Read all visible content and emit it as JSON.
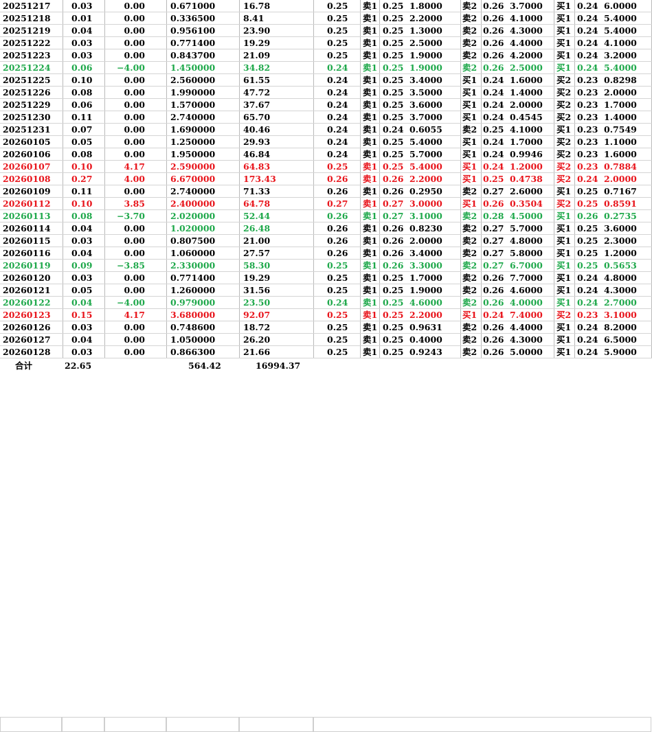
{
  "colors": {
    "up": "#e8141b",
    "down": "#1ea84a",
    "flat": "#000000"
  },
  "rows": [
    {
      "date": "20251217",
      "a": "0.03",
      "b": "0.00",
      "c": "0.671000",
      "d": "16.78",
      "p": "0.25",
      "s1l": "卖1",
      "s1p": "0.25",
      "s1v": "1.8000",
      "s2l": "卖2",
      "s2p": "0.26",
      "s2v": "3.7000",
      "b1l": "买1",
      "b1p": "0.24",
      "b1v": "6.0000",
      "t": "flat"
    },
    {
      "date": "20251218",
      "a": "0.01",
      "b": "0.00",
      "c": "0.336500",
      "d": "8.41",
      "p": "0.25",
      "s1l": "卖1",
      "s1p": "0.25",
      "s1v": "2.2000",
      "s2l": "卖2",
      "s2p": "0.26",
      "s2v": "4.1000",
      "b1l": "买1",
      "b1p": "0.24",
      "b1v": "5.4000",
      "t": "flat"
    },
    {
      "date": "20251219",
      "a": "0.04",
      "b": "0.00",
      "c": "0.956100",
      "d": "23.90",
      "p": "0.25",
      "s1l": "卖1",
      "s1p": "0.25",
      "s1v": "1.3000",
      "s2l": "卖2",
      "s2p": "0.26",
      "s2v": "4.3000",
      "b1l": "买1",
      "b1p": "0.24",
      "b1v": "5.4000",
      "t": "flat"
    },
    {
      "date": "20251222",
      "a": "0.03",
      "b": "0.00",
      "c": "0.771400",
      "d": "19.29",
      "p": "0.25",
      "s1l": "卖1",
      "s1p": "0.25",
      "s1v": "2.5000",
      "s2l": "卖2",
      "s2p": "0.26",
      "s2v": "4.4000",
      "b1l": "买1",
      "b1p": "0.24",
      "b1v": "4.1000",
      "t": "flat"
    },
    {
      "date": "20251223",
      "a": "0.03",
      "b": "0.00",
      "c": "0.843700",
      "d": "21.09",
      "p": "0.25",
      "s1l": "卖1",
      "s1p": "0.25",
      "s1v": "1.9000",
      "s2l": "卖2",
      "s2p": "0.26",
      "s2v": "4.2000",
      "b1l": "买1",
      "b1p": "0.24",
      "b1v": "3.2000",
      "t": "flat"
    },
    {
      "date": "20251224",
      "a": "0.06",
      "b": "−4.00",
      "c": "1.450000",
      "d": "34.82",
      "p": "0.24",
      "s1l": "卖1",
      "s1p": "0.25",
      "s1v": "1.9000",
      "s2l": "卖2",
      "s2p": "0.26",
      "s2v": "2.5000",
      "b1l": "买1",
      "b1p": "0.24",
      "b1v": "5.4000",
      "t": "down"
    },
    {
      "date": "20251225",
      "a": "0.10",
      "b": "0.00",
      "c": "2.560000",
      "d": "61.55",
      "p": "0.24",
      "s1l": "卖1",
      "s1p": "0.25",
      "s1v": "3.4000",
      "s2l": "买1",
      "s2p": "0.24",
      "s2v": "1.6000",
      "b1l": "买2",
      "b1p": "0.23",
      "b1v": "0.8298",
      "t": "flat"
    },
    {
      "date": "20251226",
      "a": "0.08",
      "b": "0.00",
      "c": "1.990000",
      "d": "47.72",
      "p": "0.24",
      "s1l": "卖1",
      "s1p": "0.25",
      "s1v": "3.5000",
      "s2l": "买1",
      "s2p": "0.24",
      "s2v": "1.4000",
      "b1l": "买2",
      "b1p": "0.23",
      "b1v": "2.0000",
      "t": "flat"
    },
    {
      "date": "20251229",
      "a": "0.06",
      "b": "0.00",
      "c": "1.570000",
      "d": "37.67",
      "p": "0.24",
      "s1l": "卖1",
      "s1p": "0.25",
      "s1v": "3.6000",
      "s2l": "买1",
      "s2p": "0.24",
      "s2v": "2.0000",
      "b1l": "买2",
      "b1p": "0.23",
      "b1v": "1.7000",
      "t": "flat"
    },
    {
      "date": "20251230",
      "a": "0.11",
      "b": "0.00",
      "c": "2.740000",
      "d": "65.70",
      "p": "0.24",
      "s1l": "卖1",
      "s1p": "0.25",
      "s1v": "3.7000",
      "s2l": "买1",
      "s2p": "0.24",
      "s2v": "0.4545",
      "b1l": "买2",
      "b1p": "0.23",
      "b1v": "1.4000",
      "t": "flat"
    },
    {
      "date": "20251231",
      "a": "0.07",
      "b": "0.00",
      "c": "1.690000",
      "d": "40.46",
      "p": "0.24",
      "s1l": "卖1",
      "s1p": "0.24",
      "s1v": "0.6055",
      "s2l": "卖2",
      "s2p": "0.25",
      "s2v": "4.1000",
      "b1l": "买1",
      "b1p": "0.23",
      "b1v": "0.7549",
      "t": "flat"
    },
    {
      "date": "20260105",
      "a": "0.05",
      "b": "0.00",
      "c": "1.250000",
      "d": "29.93",
      "p": "0.24",
      "s1l": "卖1",
      "s1p": "0.25",
      "s1v": "5.4000",
      "s2l": "买1",
      "s2p": "0.24",
      "s2v": "1.7000",
      "b1l": "买2",
      "b1p": "0.23",
      "b1v": "1.1000",
      "t": "flat"
    },
    {
      "date": "20260106",
      "a": "0.08",
      "b": "0.00",
      "c": "1.950000",
      "d": "46.84",
      "p": "0.24",
      "s1l": "卖1",
      "s1p": "0.25",
      "s1v": "5.7000",
      "s2l": "买1",
      "s2p": "0.24",
      "s2v": "0.9946",
      "b1l": "买2",
      "b1p": "0.23",
      "b1v": "1.6000",
      "t": "flat"
    },
    {
      "date": "20260107",
      "a": "0.10",
      "b": "4.17",
      "c": "2.590000",
      "d": "64.83",
      "p": "0.25",
      "s1l": "卖1",
      "s1p": "0.25",
      "s1v": "5.4000",
      "s2l": "买1",
      "s2p": "0.24",
      "s2v": "1.2000",
      "b1l": "买2",
      "b1p": "0.23",
      "b1v": "0.7884",
      "t": "up"
    },
    {
      "date": "20260108",
      "a": "0.27",
      "b": "4.00",
      "c": "6.670000",
      "d": "173.43",
      "p": "0.26",
      "s1l": "卖1",
      "s1p": "0.26",
      "s1v": "2.2000",
      "s2l": "买1",
      "s2p": "0.25",
      "s2v": "0.4738",
      "b1l": "买2",
      "b1p": "0.24",
      "b1v": "2.0000",
      "t": "up"
    },
    {
      "date": "20260109",
      "a": "0.11",
      "b": "0.00",
      "c": "2.740000",
      "d": "71.33",
      "p": "0.26",
      "s1l": "卖1",
      "s1p": "0.26",
      "s1v": "0.2950",
      "s2l": "卖2",
      "s2p": "0.27",
      "s2v": "2.6000",
      "b1l": "买1",
      "b1p": "0.25",
      "b1v": "0.7167",
      "t": "flat"
    },
    {
      "date": "20260112",
      "a": "0.10",
      "b": "3.85",
      "c": "2.400000",
      "d": "64.78",
      "p": "0.27",
      "s1l": "卖1",
      "s1p": "0.27",
      "s1v": "3.0000",
      "s2l": "买1",
      "s2p": "0.26",
      "s2v": "0.3504",
      "b1l": "买2",
      "b1p": "0.25",
      "b1v": "0.8591",
      "t": "up"
    },
    {
      "date": "20260113",
      "a": "0.08",
      "b": "−3.70",
      "c": "2.020000",
      "d": "52.44",
      "p": "0.26",
      "s1l": "卖1",
      "s1p": "0.27",
      "s1v": "3.1000",
      "s2l": "卖2",
      "s2p": "0.28",
      "s2v": "4.5000",
      "b1l": "买1",
      "b1p": "0.26",
      "b1v": "0.2735",
      "t": "down"
    },
    {
      "date": "20260114",
      "a": "0.04",
      "b": "0.00",
      "c": "1.020000",
      "d": "26.48",
      "p": "0.26",
      "s1l": "卖1",
      "s1p": "0.26",
      "s1v": "0.8230",
      "s2l": "卖2",
      "s2p": "0.27",
      "s2v": "5.7000",
      "b1l": "买1",
      "b1p": "0.25",
      "b1v": "3.6000",
      "t": "flat",
      "cd": "down"
    },
    {
      "date": "20260115",
      "a": "0.03",
      "b": "0.00",
      "c": "0.807500",
      "d": "21.00",
      "p": "0.26",
      "s1l": "卖1",
      "s1p": "0.26",
      "s1v": "2.0000",
      "s2l": "卖2",
      "s2p": "0.27",
      "s2v": "4.8000",
      "b1l": "买1",
      "b1p": "0.25",
      "b1v": "2.3000",
      "t": "flat"
    },
    {
      "date": "20260116",
      "a": "0.04",
      "b": "0.00",
      "c": "1.060000",
      "d": "27.57",
      "p": "0.26",
      "s1l": "卖1",
      "s1p": "0.26",
      "s1v": "3.4000",
      "s2l": "卖2",
      "s2p": "0.27",
      "s2v": "5.8000",
      "b1l": "买1",
      "b1p": "0.25",
      "b1v": "1.2000",
      "t": "flat"
    },
    {
      "date": "20260119",
      "a": "0.09",
      "b": "−3.85",
      "c": "2.330000",
      "d": "58.30",
      "p": "0.25",
      "s1l": "卖1",
      "s1p": "0.26",
      "s1v": "3.3000",
      "s2l": "卖2",
      "s2p": "0.27",
      "s2v": "6.7000",
      "b1l": "买1",
      "b1p": "0.25",
      "b1v": "0.5653",
      "t": "down"
    },
    {
      "date": "20260120",
      "a": "0.03",
      "b": "0.00",
      "c": "0.771400",
      "d": "19.29",
      "p": "0.25",
      "s1l": "卖1",
      "s1p": "0.25",
      "s1v": "1.7000",
      "s2l": "卖2",
      "s2p": "0.26",
      "s2v": "7.7000",
      "b1l": "买1",
      "b1p": "0.24",
      "b1v": "4.8000",
      "t": "flat"
    },
    {
      "date": "20260121",
      "a": "0.05",
      "b": "0.00",
      "c": "1.260000",
      "d": "31.56",
      "p": "0.25",
      "s1l": "卖1",
      "s1p": "0.25",
      "s1v": "1.9000",
      "s2l": "卖2",
      "s2p": "0.26",
      "s2v": "4.6000",
      "b1l": "买1",
      "b1p": "0.24",
      "b1v": "4.3000",
      "t": "flat"
    },
    {
      "date": "20260122",
      "a": "0.04",
      "b": "−4.00",
      "c": "0.979000",
      "d": "23.50",
      "p": "0.24",
      "s1l": "卖1",
      "s1p": "0.25",
      "s1v": "4.6000",
      "s2l": "卖2",
      "s2p": "0.26",
      "s2v": "4.0000",
      "b1l": "买1",
      "b1p": "0.24",
      "b1v": "2.7000",
      "t": "down"
    },
    {
      "date": "20260123",
      "a": "0.15",
      "b": "4.17",
      "c": "3.680000",
      "d": "92.07",
      "p": "0.25",
      "s1l": "卖1",
      "s1p": "0.25",
      "s1v": "2.2000",
      "s2l": "买1",
      "s2p": "0.24",
      "s2v": "7.4000",
      "b1l": "买2",
      "b1p": "0.23",
      "b1v": "3.1000",
      "t": "up"
    },
    {
      "date": "20260126",
      "a": "0.03",
      "b": "0.00",
      "c": "0.748600",
      "d": "18.72",
      "p": "0.25",
      "s1l": "卖1",
      "s1p": "0.25",
      "s1v": "0.9631",
      "s2l": "卖2",
      "s2p": "0.26",
      "s2v": "4.4000",
      "b1l": "买1",
      "b1p": "0.24",
      "b1v": "8.2000",
      "t": "flat"
    },
    {
      "date": "20260127",
      "a": "0.04",
      "b": "0.00",
      "c": "1.050000",
      "d": "26.20",
      "p": "0.25",
      "s1l": "卖1",
      "s1p": "0.25",
      "s1v": "0.4000",
      "s2l": "卖2",
      "s2p": "0.26",
      "s2v": "4.3000",
      "b1l": "买1",
      "b1p": "0.24",
      "b1v": "6.5000",
      "t": "flat"
    },
    {
      "date": "20260128",
      "a": "0.03",
      "b": "0.00",
      "c": "0.866300",
      "d": "21.66",
      "p": "0.25",
      "s1l": "卖1",
      "s1p": "0.25",
      "s1v": "0.9243",
      "s2l": "卖2",
      "s2p": "0.26",
      "s2v": "5.0000",
      "b1l": "买1",
      "b1p": "0.24",
      "b1v": "5.9000",
      "t": "flat"
    }
  ],
  "total": {
    "label": "合计",
    "a": "22.65",
    "c": "564.42",
    "d": "16994.37"
  }
}
